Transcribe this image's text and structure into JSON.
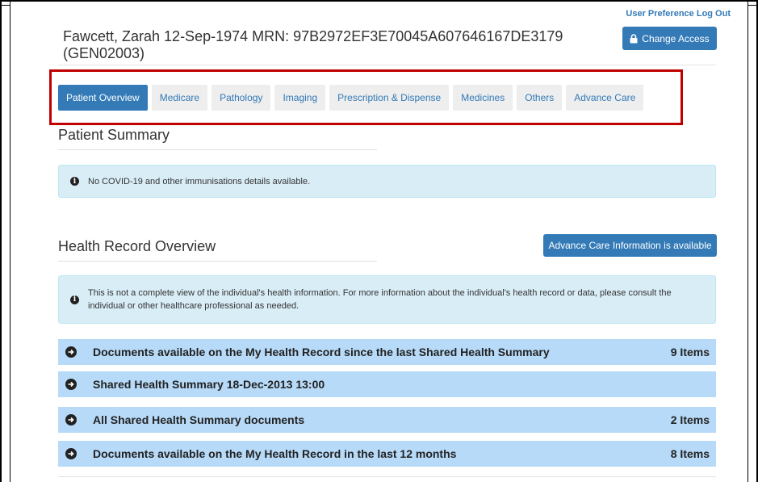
{
  "user_links": {
    "preference": "User Preference",
    "logout": "Log Out"
  },
  "patient": {
    "header_line1": "Fawcett, Zarah 12-Sep-1974 MRN: 97B2972EF3E70045A607646167DE3179",
    "header_line2": "(GEN02003)"
  },
  "change_access": {
    "label": "Change Access",
    "icon": "lock-icon"
  },
  "tabs": [
    {
      "label": "Patient Overview",
      "active": true
    },
    {
      "label": "Medicare"
    },
    {
      "label": "Pathology"
    },
    {
      "label": "Imaging"
    },
    {
      "label": "Prescription & Dispense"
    },
    {
      "label": "Medicines"
    },
    {
      "label": "Others"
    },
    {
      "label": "Advance Care"
    }
  ],
  "patient_summary": {
    "title": "Patient Summary",
    "alert": "No COVID-19 and other immunisations details available."
  },
  "health_record": {
    "title": "Health Record Overview",
    "acp_button": "Advance Care Information is available",
    "notice": "This is not a complete view of the individual's health information. For more information about the individual's health record or data, please consult the individual or other healthcare professional as needed."
  },
  "record_rows": [
    {
      "label": "Documents available on the My Health Record since the last Shared Health Summary",
      "count": "9 Items"
    },
    {
      "label": "Shared Health Summary 18-Dec-2013 13:00",
      "count": ""
    },
    {
      "label": "All Shared Health Summary documents",
      "count": "2 Items"
    },
    {
      "label": "Documents available on the My Health Record in the last 12 months",
      "count": "8 Items"
    }
  ],
  "colors": {
    "primary": "#337ab7",
    "tab_bg": "#eeeeee",
    "alert_bg": "#d9edf7",
    "row_bg": "#b7daf8",
    "highlight": "#c00000"
  }
}
